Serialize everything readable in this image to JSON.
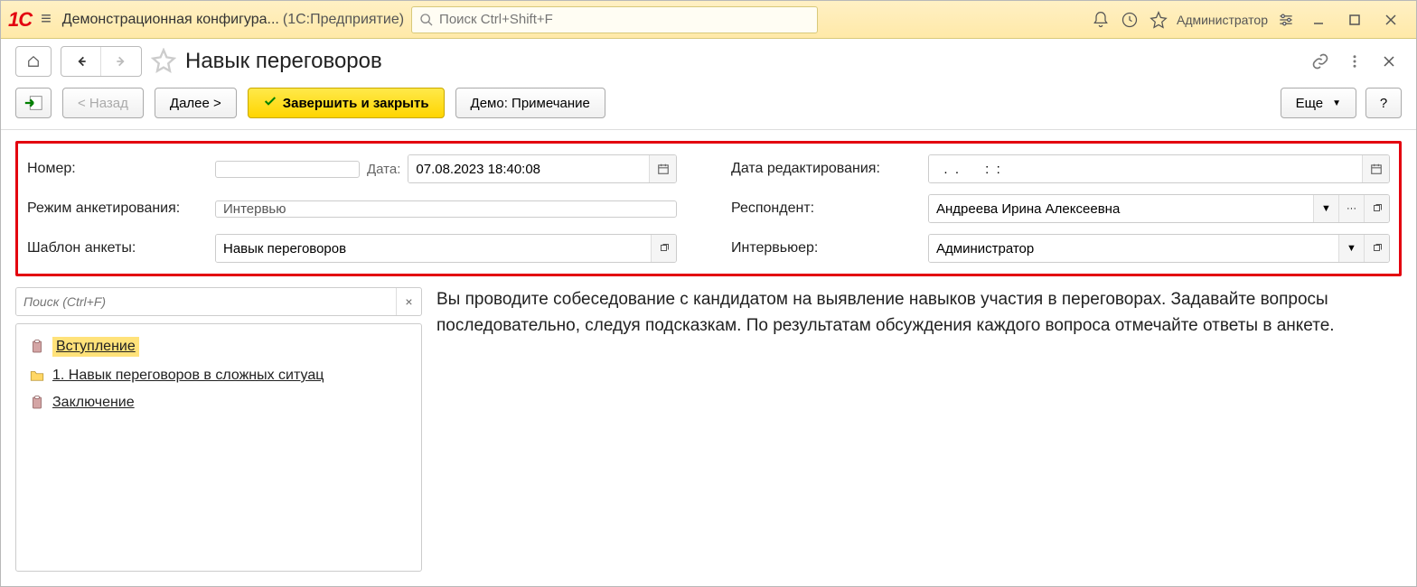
{
  "titlebar": {
    "app_title": "Демонстрационная конфигура...",
    "app_sub": "(1С:Предприятие)",
    "search_placeholder": "Поиск Ctrl+Shift+F",
    "user": "Администратор"
  },
  "page": {
    "title": "Навык переговоров"
  },
  "toolbar": {
    "back": "< Назад",
    "next": "Далее >",
    "finish": "Завершить и закрыть",
    "demo": "Демо: Примечание",
    "more": "Еще",
    "help": "?"
  },
  "form": {
    "number_label": "Номер:",
    "number_value": "",
    "date_label": "Дата:",
    "date_value": "07.08.2023 18:40:08",
    "edit_date_label": "Дата редактирования:",
    "edit_date_value": "  .  .       :  :",
    "mode_label": "Режим анкетирования:",
    "mode_value": "Интервью",
    "respondent_label": "Респондент:",
    "respondent_value": "Андреева Ирина Алексеевна",
    "template_label": "Шаблон анкеты:",
    "template_value": "Навык переговоров",
    "interviewer_label": "Интервьюер:",
    "interviewer_value": "Администратор"
  },
  "tree": {
    "search_placeholder": "Поиск (Ctrl+F)",
    "items": [
      {
        "label": "Вступление",
        "icon": "clipboard",
        "active": true
      },
      {
        "label": "1. Навык переговоров в сложных ситуац",
        "icon": "folder",
        "active": false
      },
      {
        "label": "Заключение",
        "icon": "clipboard",
        "active": false
      }
    ]
  },
  "content": {
    "text": "Вы проводите собеседование с кандидатом на выявление навыков участия в переговорах. Задавайте вопросы последовательно, следуя подсказкам. По результатам обсуждения каждого вопроса отмечайте ответы в анкете."
  }
}
